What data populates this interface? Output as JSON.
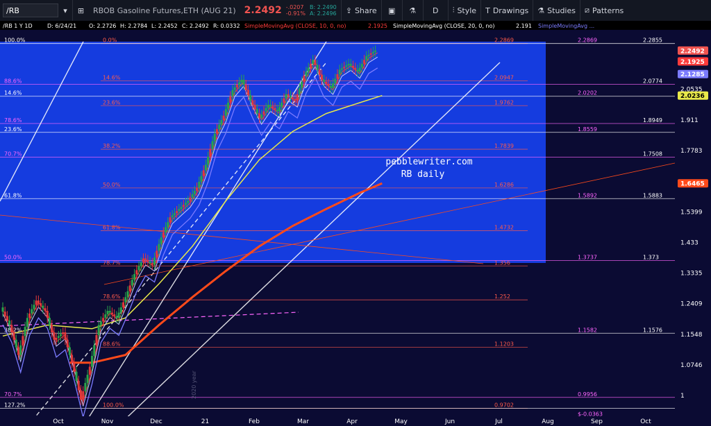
{
  "toolbar": {
    "symbol": "/RB",
    "instrument_name": "RBOB Gasoline Futures,ETH (AUG 21)",
    "last_price": "2.2492",
    "change": "-.0207",
    "change_pct": "-0.91%",
    "bid": "B: 2.2490",
    "ask": "A: 2.2496",
    "share_label": "Share",
    "timeframe_label": "D",
    "style_label": "Style",
    "drawings_label": "Drawings",
    "studies_label": "Studies",
    "patterns_label": "Patterns"
  },
  "legend": {
    "symbol_line": "/RB 1 Y 1D",
    "date": "D: 6/24/21",
    "open": "O: 2.2726",
    "high": "H: 2.2784",
    "low": "L: 2.2452",
    "close": "C: 2.2492",
    "range": "R: 0.0332",
    "sma10": "SimpleMovingAvg (CLOSE, 10, 0, no)",
    "sma10_value": "2.1925",
    "sma20": "SimpleMovingAvg (CLOSE, 20, 0, no)",
    "sma20_value": "2.191",
    "sma_more": "SimpleMovingAvg ..."
  },
  "watermark": {
    "line1": "pebblewriter.com",
    "line2": "RB daily",
    "year_label": "2020 year"
  },
  "colors": {
    "background": "#0b0b33",
    "fib_box": "#1741ee",
    "candle_up": "#2aa44a",
    "candle_down": "#e23a3a",
    "sma_10": "#ff3b3b",
    "sma_20": "#c8c8ff",
    "sma_50": "#7b7bff",
    "sma_100": "#e8e84a",
    "sma_200": "#ff4a1a",
    "channel": "#ffffff",
    "fib_red": "#ff5a4a",
    "fib_magenta": "#ff66ff",
    "fib_white": "#ffffff"
  },
  "chart_data": {
    "type": "candlestick",
    "title": "RBOB Gasoline Futures,ETH (AUG 21)",
    "x_tick_labels": [
      "Oct",
      "Nov",
      "Dec",
      "21",
      "Feb",
      "Mar",
      "Apr",
      "May",
      "Jun",
      "Jul",
      "Aug",
      "Sep",
      "Oct"
    ],
    "y_tick_labels": [
      "2.0535",
      "1.911",
      "1.7783",
      "1.5399",
      "1.433",
      "1.3335",
      "1.2409",
      "1.1548",
      "1.0746",
      "1"
    ],
    "ylim": [
      0.94,
      2.35
    ],
    "y_scale": "log",
    "grid": false,
    "price_badges": [
      {
        "value": "2.2492",
        "color": "#ef5350"
      },
      {
        "value": "2.1925",
        "color": "#ff3b3b"
      },
      {
        "value": "2.1285",
        "color": "#7b7bff"
      },
      {
        "value": "2.0236",
        "color": "#e8e84a"
      },
      {
        "value": "1.6465",
        "color": "#ff4a1a"
      }
    ],
    "fib_left_labels": [
      {
        "label": "100.0%",
        "value": 2.2869
      },
      {
        "label": "88.6%",
        "value": 2.0774
      },
      {
        "label": "14.6%",
        "value": 2.0202
      },
      {
        "label": "78.6%",
        "value": 1.8949
      },
      {
        "label": "23.6%",
        "value": 1.8559
      },
      {
        "label": "70.7%",
        "value": 1.7508
      },
      {
        "label": "61.8%",
        "value": 1.5883
      },
      {
        "label": "50.0%",
        "value": 1.373
      },
      {
        "label": "38.2%",
        "value": 1.1576
      },
      {
        "label": "70.7%",
        "value": 0.9956
      },
      {
        "label": "127.2%",
        "value": 0.9702
      }
    ],
    "fib_mid_levels": [
      {
        "label": "0.0%",
        "price": "2.2869",
        "value": 2.2869
      },
      {
        "label": "14.6%",
        "price": "2.0947",
        "value": 2.0947
      },
      {
        "label": "23.6%",
        "price": "1.9762",
        "value": 1.9762
      },
      {
        "label": "38.2%",
        "price": "1.7839",
        "value": 1.7839
      },
      {
        "label": "50.0%",
        "price": "1.6286",
        "value": 1.6286
      },
      {
        "label": "61.8%",
        "price": "1.4732",
        "value": 1.4732
      },
      {
        "label": "78.7%",
        "price": "1.356",
        "value": 1.356
      },
      {
        "label": "78.6%",
        "price": "1.252",
        "value": 1.252
      },
      {
        "label": "88.6%",
        "price": "1.1203",
        "value": 1.1203
      },
      {
        "label": "100.0%",
        "price": "0.9702",
        "value": 0.9702
      }
    ],
    "fib_right_levels": [
      {
        "pink": "2.2869",
        "white": "2.2855",
        "value": 2.2869
      },
      {
        "pink": "",
        "white": "2.0774",
        "value": 2.0774
      },
      {
        "pink": "2.0202",
        "white": "",
        "value": 2.0202
      },
      {
        "pink": "",
        "white": "1.8949",
        "value": 1.8949
      },
      {
        "pink": "1.8559",
        "white": "",
        "value": 1.8559
      },
      {
        "pink": "",
        "white": "1.7508",
        "value": 1.7508
      },
      {
        "pink": "1.5892",
        "white": "1.5883",
        "value": 1.5883
      },
      {
        "pink": "1.3737",
        "white": "1.373",
        "value": 1.373
      },
      {
        "pink": "1.1582",
        "white": "1.1576",
        "value": 1.1576
      },
      {
        "pink": "0.9956",
        "white": "",
        "value": 0.9956
      },
      {
        "pink": "$-0.0363",
        "white": "",
        "value": 0.95
      }
    ],
    "price_path": [
      {
        "t": 0,
        "p": 1.23
      },
      {
        "t": 4,
        "p": 1.18
      },
      {
        "t": 8,
        "p": 1.1
      },
      {
        "t": 12,
        "p": 1.2
      },
      {
        "t": 16,
        "p": 1.25
      },
      {
        "t": 20,
        "p": 1.22
      },
      {
        "t": 24,
        "p": 1.14
      },
      {
        "t": 28,
        "p": 1.16
      },
      {
        "t": 32,
        "p": 1.08
      },
      {
        "t": 36,
        "p": 0.99
      },
      {
        "t": 40,
        "p": 1.07
      },
      {
        "t": 44,
        "p": 1.18
      },
      {
        "t": 48,
        "p": 1.22
      },
      {
        "t": 52,
        "p": 1.2
      },
      {
        "t": 56,
        "p": 1.26
      },
      {
        "t": 60,
        "p": 1.33
      },
      {
        "t": 64,
        "p": 1.38
      },
      {
        "t": 68,
        "p": 1.36
      },
      {
        "t": 72,
        "p": 1.45
      },
      {
        "t": 76,
        "p": 1.52
      },
      {
        "t": 80,
        "p": 1.55
      },
      {
        "t": 84,
        "p": 1.58
      },
      {
        "t": 88,
        "p": 1.63
      },
      {
        "t": 92,
        "p": 1.72
      },
      {
        "t": 96,
        "p": 1.85
      },
      {
        "t": 100,
        "p": 1.93
      },
      {
        "t": 104,
        "p": 2.05
      },
      {
        "t": 108,
        "p": 2.1
      },
      {
        "t": 112,
        "p": 2.0
      },
      {
        "t": 116,
        "p": 1.92
      },
      {
        "t": 120,
        "p": 1.98
      },
      {
        "t": 124,
        "p": 1.95
      },
      {
        "t": 128,
        "p": 2.03
      },
      {
        "t": 132,
        "p": 2.0
      },
      {
        "t": 136,
        "p": 2.12
      },
      {
        "t": 140,
        "p": 2.2
      },
      {
        "t": 144,
        "p": 2.1
      },
      {
        "t": 148,
        "p": 2.06
      },
      {
        "t": 152,
        "p": 2.15
      },
      {
        "t": 156,
        "p": 2.18
      },
      {
        "t": 160,
        "p": 2.14
      },
      {
        "t": 164,
        "p": 2.22
      },
      {
        "t": 168,
        "p": 2.2492
      }
    ],
    "sma_200_path": [
      {
        "t": 30,
        "p": 1.08
      },
      {
        "t": 40,
        "p": 1.08
      },
      {
        "t": 55,
        "p": 1.1
      },
      {
        "t": 70,
        "p": 1.18
      },
      {
        "t": 85,
        "p": 1.26
      },
      {
        "t": 100,
        "p": 1.34
      },
      {
        "t": 115,
        "p": 1.42
      },
      {
        "t": 130,
        "p": 1.49
      },
      {
        "t": 145,
        "p": 1.55
      },
      {
        "t": 160,
        "p": 1.61
      },
      {
        "t": 170,
        "p": 1.6465
      }
    ],
    "sma_100_path": [
      {
        "t": 0,
        "p": 1.15
      },
      {
        "t": 20,
        "p": 1.18
      },
      {
        "t": 40,
        "p": 1.17
      },
      {
        "t": 55,
        "p": 1.2
      },
      {
        "t": 70,
        "p": 1.3
      },
      {
        "t": 85,
        "p": 1.42
      },
      {
        "t": 100,
        "p": 1.58
      },
      {
        "t": 115,
        "p": 1.74
      },
      {
        "t": 130,
        "p": 1.86
      },
      {
        "t": 145,
        "p": 1.94
      },
      {
        "t": 160,
        "p": 1.99
      },
      {
        "t": 170,
        "p": 2.0236
      }
    ]
  }
}
